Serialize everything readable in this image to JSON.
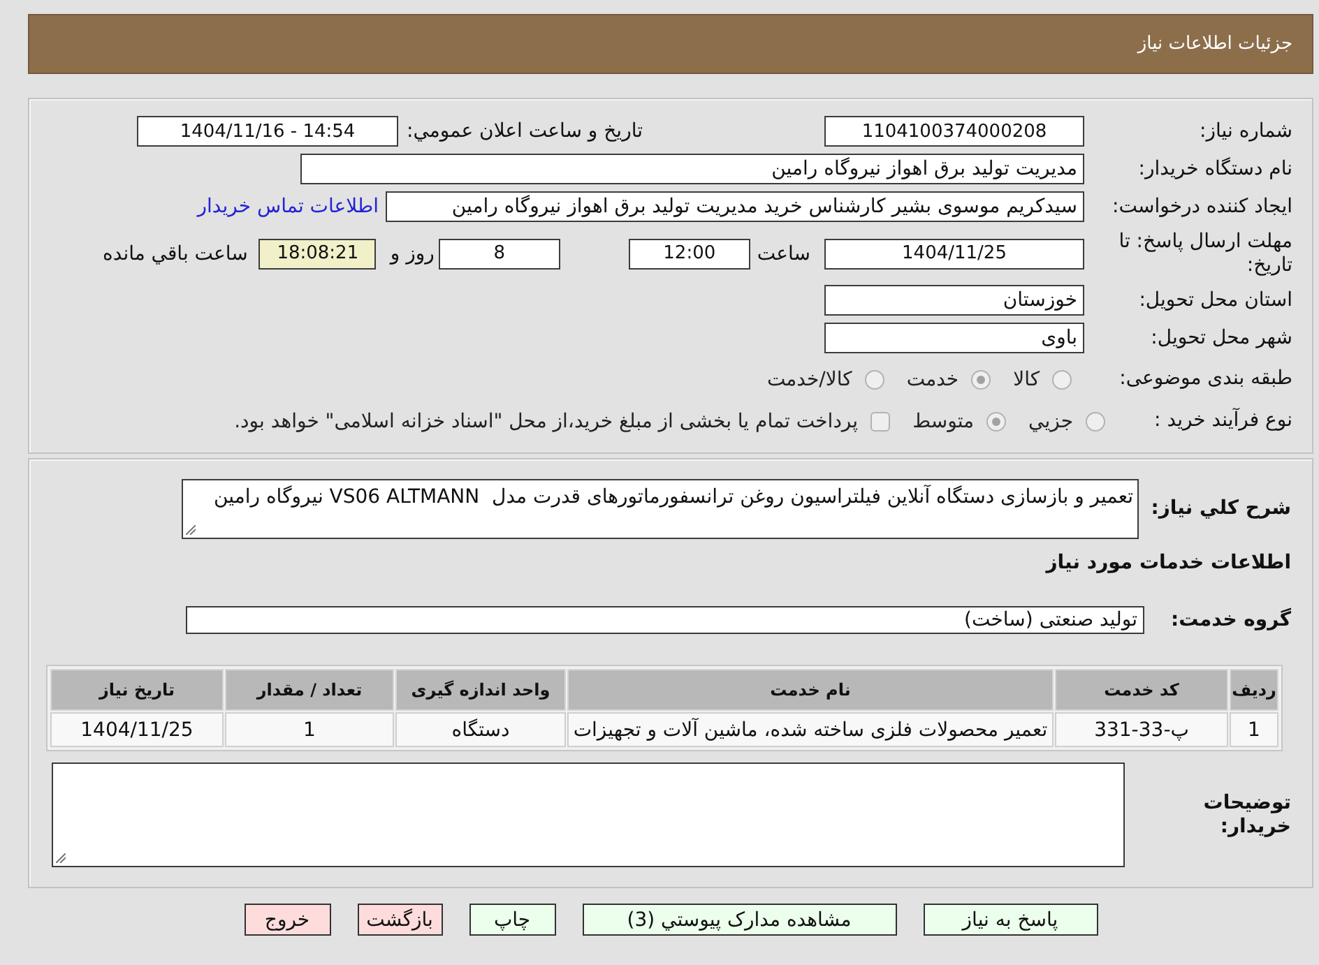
{
  "header": {
    "title": "جزئیات اطلاعات نیاز"
  },
  "details": {
    "need_number": {
      "label": "شماره نیاز:",
      "value": "1104100374000208"
    },
    "announce_datetime": {
      "label": "تاریخ و ساعت اعلان عمومي:",
      "value": "1404/11/16 - 14:54"
    },
    "buyer_org": {
      "label": "نام دستگاه خریدار:",
      "value": "مدیریت تولید برق اهواز نیروگاه رامین"
    },
    "requester": {
      "label": "ایجاد کننده درخواست:",
      "value": "سیدکریم موسوی بشیر کارشناس خرید مدیریت تولید برق اهواز نیروگاه رامین",
      "contact_link": "اطلاعات تماس خریدار"
    },
    "deadline": {
      "label": "مهلت ارسال پاسخ: تا تاریخ:",
      "date": "1404/11/25",
      "time_label": "ساعت",
      "time": "12:00",
      "days": "8",
      "days_label": "روز و",
      "remaining": "18:08:21",
      "remaining_label": "ساعت باقي مانده"
    },
    "province": {
      "label": "استان محل تحویل:",
      "value": "خوزستان"
    },
    "city": {
      "label": "شهر محل تحویل:",
      "value": "باوی"
    },
    "category": {
      "label": "طبقه بندی موضوعی:",
      "disabled": true,
      "options": [
        {
          "label": "کالا",
          "selected": false
        },
        {
          "label": "خدمت",
          "selected": true
        },
        {
          "label": "کالا/خدمت",
          "selected": false
        }
      ]
    },
    "purchase_process": {
      "label": "نوع فرآیند خرید :",
      "disabled": true,
      "options": [
        {
          "label": "جزيي",
          "selected": false
        },
        {
          "label": "متوسط",
          "selected": true
        }
      ],
      "treasury_option": {
        "label": "پرداخت تمام یا بخشی از مبلغ خرید،از محل \"اسناد خزانه اسلامی\" خواهد بود.",
        "checked": false
      }
    }
  },
  "needs": {
    "description": {
      "label": "شرح کلي نیاز:",
      "value": "تعمیر و بازسازی دستگاه آنلاین فیلتراسیون روغن ترانسفورماتورهای قدرت مدل  VS06 ALTMANN نیروگاه رامین"
    },
    "services_title": "اطلاعات خدمات مورد نیاز",
    "service_group": {
      "label": "گروه خدمت:",
      "value": "تولید صنعتی (ساخت)"
    },
    "table": {
      "columns": [
        "ردیف",
        "کد خدمت",
        "نام خدمت",
        "واحد اندازه گیری",
        "تعداد / مقدار",
        "تاریخ نیاز"
      ],
      "rows": [
        [
          "1",
          "پ-33-331",
          "تعمیر محصولات فلزی ساخته شده، ماشین آلات و تجهیزات",
          "دستگاه",
          "1",
          "1404/11/25"
        ]
      ]
    },
    "buyer_notes": {
      "label": "توضیحات خریدار:"
    }
  },
  "buttons": [
    {
      "label": "پاسخ به نیاز",
      "kind": "action"
    },
    {
      "label": "مشاهده مدارک پیوستي (3)",
      "kind": "action"
    },
    {
      "label": "چاپ",
      "kind": "action"
    },
    {
      "label": "بازگشت",
      "kind": "exit"
    },
    {
      "label": "خروج",
      "kind": "exit"
    }
  ]
}
